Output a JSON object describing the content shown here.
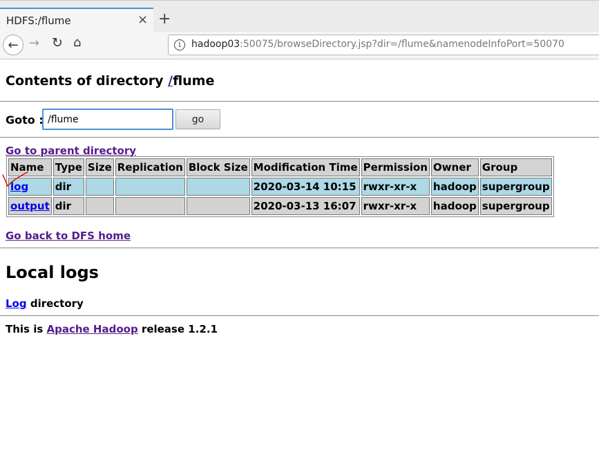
{
  "browser": {
    "tab_title": "HDFS:/flume",
    "close_glyph": "×",
    "new_tab_glyph": "+",
    "url_host": "hadoop03",
    "url_rest": ":50075/browseDirectory.jsp?dir=/flume&namenodeInfoPort=50070"
  },
  "page": {
    "heading_prefix": "Contents of directory ",
    "heading_root": "/",
    "heading_dir": "flume",
    "goto_label": "Goto :",
    "goto_value": "/flume",
    "go_label": "go",
    "parent_link": "Go to parent directory",
    "home_link": "Go back to DFS home",
    "local_logs_heading": "Local logs",
    "log_link": "Log",
    "log_suffix": " directory",
    "release_prefix": "This is ",
    "release_link": "Apache Hadoop",
    "release_suffix": " release 1.2.1"
  },
  "table": {
    "headers": [
      "Name",
      "Type",
      "Size",
      "Replication",
      "Block Size",
      "Modification Time",
      "Permission",
      "Owner",
      "Group"
    ],
    "rows": [
      {
        "name": "log",
        "type": "dir",
        "size": "",
        "replication": "",
        "block_size": "",
        "mtime": "2020-03-14 10:15",
        "permission": "rwxr-xr-x",
        "owner": "hadoop",
        "group": "supergroup"
      },
      {
        "name": "output",
        "type": "dir",
        "size": "",
        "replication": "",
        "block_size": "",
        "mtime": "2020-03-13 16:07",
        "permission": "rwxr-xr-x",
        "owner": "hadoop",
        "group": "supergroup"
      }
    ]
  },
  "colors": {
    "link_visited": "#551a8b",
    "link": "#0000ee",
    "row_highlight": "#add8e6",
    "row_normal": "#d3d3d3",
    "annotation": "#e00000"
  },
  "icons": {
    "back": "arrow-left-icon",
    "forward": "arrow-right-icon",
    "reload": "reload-icon",
    "home": "home-icon",
    "info": "info-icon"
  }
}
